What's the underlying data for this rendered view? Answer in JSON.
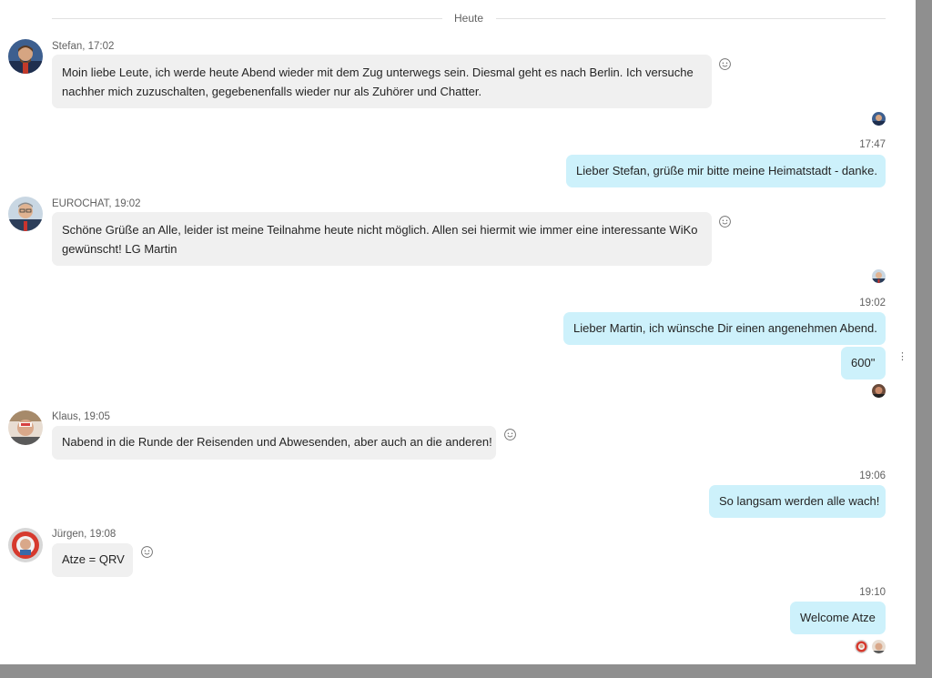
{
  "day_separator": "Heute",
  "messages": [
    {
      "sender": "Stefan, 17:02",
      "text": "Moin liebe Leute, ich werde heute Abend wieder mit dem Zug unterwegs sein. Diesmal geht es nach Berlin. Ich versuche nachher mich zuzuschalten, gegebenenfalls wieder nur als Zuhörer und Chatter."
    },
    {
      "time": "17:47",
      "text": "Lieber Stefan, grüße mir bitte meine Heimatstadt - danke."
    },
    {
      "sender": "EUROCHAT, 19:02",
      "text": "Schöne Grüße an Alle, leider ist   meine Teilnahme heute nicht möglich. Allen sei hiermit wie immer eine interessante WiKo gewünscht! LG Martin"
    },
    {
      "time": "19:02",
      "text": "Lieber Martin, ich wünsche Dir einen angenehmen Abend."
    },
    {
      "text": "600\""
    },
    {
      "sender": "Klaus, 19:05",
      "text": "Nabend in die Runde der Reisenden und Abwesenden, aber auch an die anderen!"
    },
    {
      "time": "19:06",
      "text": "So langsam werden alle wach!"
    },
    {
      "sender": "Jürgen, 19:08",
      "text": "Atze = QRV"
    },
    {
      "time": "19:10",
      "text": "Welcome Atze"
    }
  ],
  "icons": {
    "reaction": "smiley-icon",
    "more": "more-options-icon"
  },
  "colors": {
    "incoming_bubble": "#f0f0f0",
    "outgoing_bubble": "#cdf1fb",
    "background": "#ffffff"
  }
}
